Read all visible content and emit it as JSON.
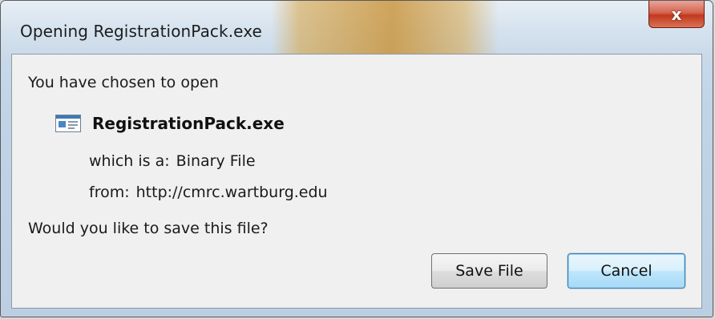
{
  "window": {
    "title": "Opening RegistrationPack.exe",
    "close_glyph": "x"
  },
  "dialog": {
    "intro": "You have chosen to open",
    "file_icon": "window-app-icon",
    "file_name": "RegistrationPack.exe",
    "type_label": "which is a:",
    "type_value": "Binary File",
    "from_label": "from:",
    "from_value": "http://cmrc.wartburg.edu",
    "question": "Would you like to save this file?"
  },
  "buttons": {
    "save_label": "Save File",
    "cancel_label": "Cancel"
  },
  "colors": {
    "close_button": "#c2381e",
    "focused_button_border": "#3c7fb1"
  }
}
